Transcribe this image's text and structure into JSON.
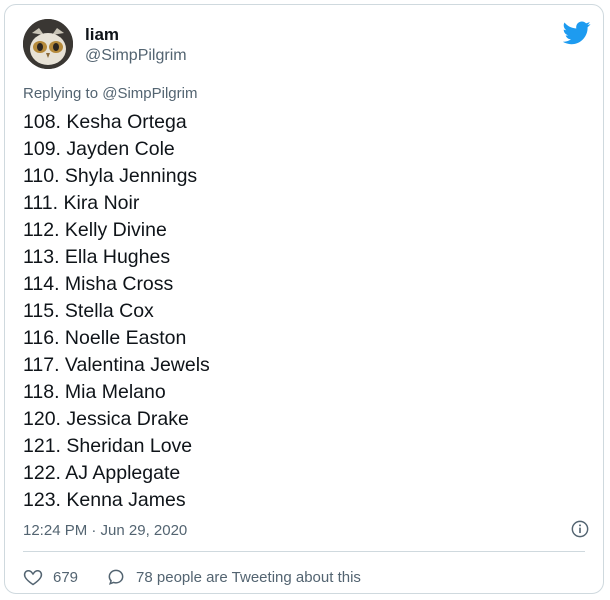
{
  "tweet": {
    "author": {
      "name": "liam",
      "handle": "@SimpPilgrim"
    },
    "reply_context": {
      "prefix": "Replying to",
      "mention": "@SimpPilgrim"
    },
    "lines": [
      "108. Kesha Ortega",
      "109. Jayden Cole",
      "110. Shyla Jennings",
      "111. Kira Noir",
      "112. Kelly Divine",
      "113. Ella Hughes",
      "114. Misha Cross",
      "115. Stella Cox",
      "116. Noelle Easton",
      "117. Valentina Jewels",
      "118. Mia Melano",
      "120. Jessica Drake",
      "121. Sheridan Love",
      "122. AJ Applegate",
      "123. Kenna James"
    ],
    "timestamp": "12:24 PM · Jun 29, 2020",
    "likes": "679",
    "retweets_text": "78 people are Tweeting about this"
  },
  "icons": {
    "brand": "twitter-bird-icon",
    "info": "info-icon",
    "like": "heart-icon",
    "reply": "speech-bubble-icon"
  },
  "colors": {
    "brand": "#1d9bf0",
    "text": "#0f1419",
    "muted": "#536471",
    "border": "#cfd9de"
  }
}
